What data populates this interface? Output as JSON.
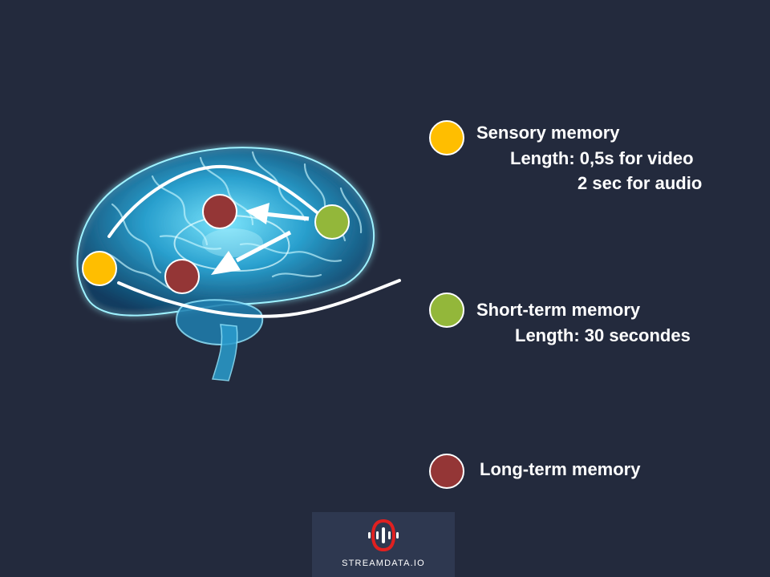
{
  "colors": {
    "background": "#232a3d",
    "sensory": "#ffbe00",
    "short_term": "#93b73a",
    "long_term": "#943636",
    "logo_panel": "#2e3850",
    "logo_accent": "#e02020"
  },
  "legend": {
    "sensory": {
      "title": "Sensory memory",
      "line1": "Length: 0,5s for video",
      "line2": "2 sec for audio"
    },
    "short_term": {
      "title": "Short-term memory",
      "line1": "Length:  30 secondes"
    },
    "long_term": {
      "title": "Long-term memory"
    }
  },
  "brain": {
    "icon": "brain-xray-illustration",
    "markers": [
      "sensory",
      "long_term",
      "long_term",
      "short_term"
    ]
  },
  "logo": {
    "text": "STREAMDATA.IO",
    "icon": "streamdata-logo-icon"
  }
}
